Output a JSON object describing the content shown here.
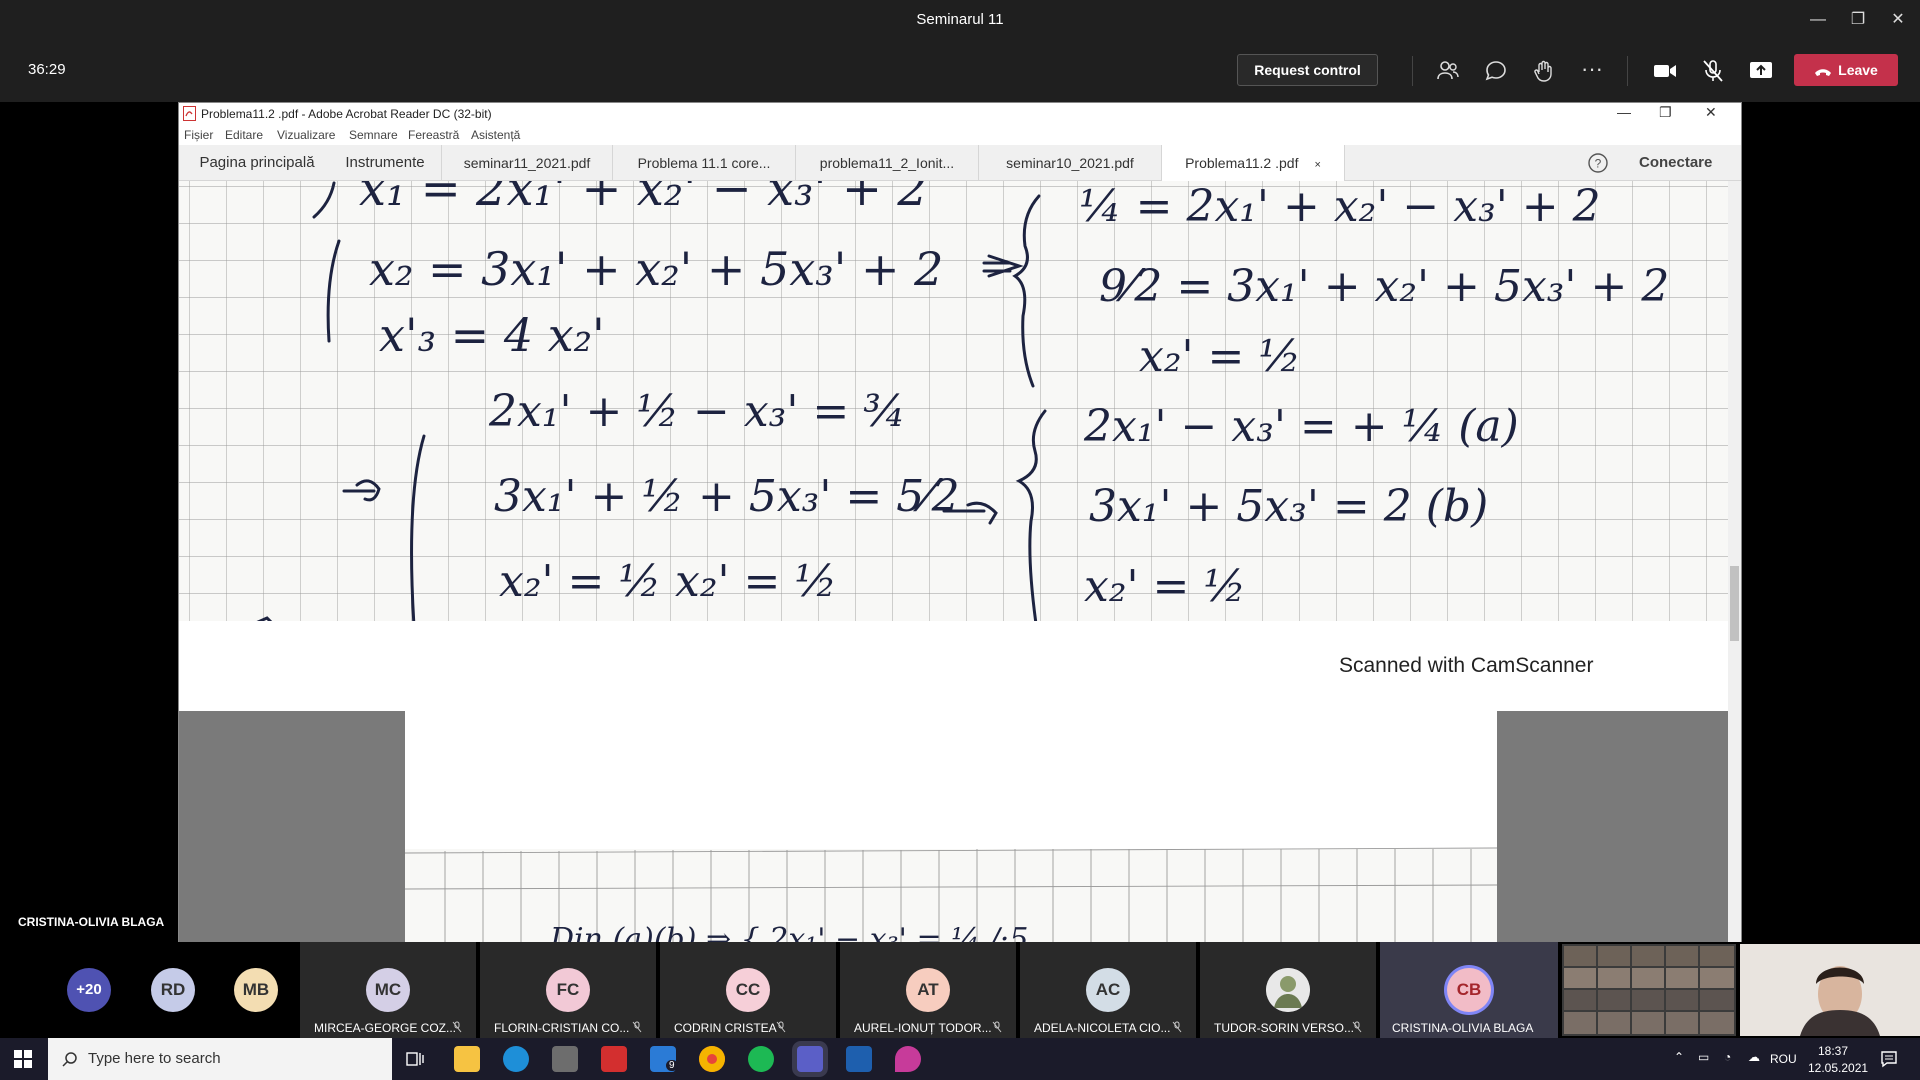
{
  "teams": {
    "meeting_title": "Seminarul 11",
    "timer": "36:29",
    "request_control": "Request control",
    "leave": "Leave",
    "presenter": "CRISTINA-OLIVIA BLAGA"
  },
  "acrobat": {
    "window_title": "Problema11.2 .pdf - Adobe Acrobat Reader DC (32-bit)",
    "menu": [
      "Fișier",
      "Editare",
      "Vizualizare",
      "Semnare",
      "Fereastră",
      "Asistență"
    ],
    "home_tab": "Pagina principală",
    "tools_tab": "Instrumente",
    "doc_tabs": [
      "seminar11_2021.pdf",
      "Problema 11.1 core...",
      "problema11_2_Ionit...",
      "seminar10_2021.pdf",
      "Problema11.2 .pdf"
    ],
    "close_tab": "×",
    "connect": "Conectare",
    "scanner_footer": "Scanned with CamScanner"
  },
  "participants": {
    "overflow": "+20",
    "avatars": [
      {
        "initials": "RD",
        "color": "#c5cbe8"
      },
      {
        "initials": "MB",
        "color": "#f3ddb2"
      }
    ],
    "tiles": [
      {
        "initials": "MC",
        "name": "MIRCEA-GEORGE COZ...",
        "color": "#d4cfe6"
      },
      {
        "initials": "FC",
        "name": "FLORIN-CRISTIAN CO...",
        "color": "#f2c9d6"
      },
      {
        "initials": "CC",
        "name": "CODRIN CRISTEA",
        "color": "#f6cfd8"
      },
      {
        "initials": "AT",
        "name": "AUREL-IONUȚ TODOR...",
        "color": "#f7cdbf"
      },
      {
        "initials": "AC",
        "name": "ADELA-NICOLETA CIO...",
        "color": "#d3dde6"
      },
      {
        "initials": "",
        "name": "TUDOR-SORIN VERSO...",
        "color": "#e8e8e8"
      },
      {
        "initials": "CB",
        "name": "CRISTINA-OLIVIA BLAGA",
        "color": "#f2bcc7"
      }
    ]
  },
  "taskbar": {
    "search_placeholder": "Type here to search",
    "mail_badge": "9",
    "language": "ROU",
    "time": "18:37",
    "date": "12.05.2021"
  }
}
